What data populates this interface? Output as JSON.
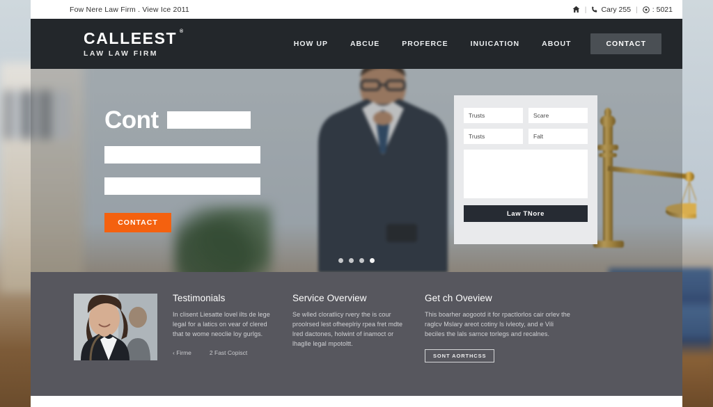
{
  "topbar": {
    "left_text": "Fow  Nere Law  Firm .  View Ice 2011",
    "home_icon": "home-icon",
    "phone_icon": "phone-icon",
    "phone_text": "Cary 255",
    "globe_icon": "globe-icon",
    "globe_text": ": 5021",
    "separator": "|"
  },
  "brand": {
    "name": "CALLEEST",
    "tm": "®",
    "tagline": "LAW LAW FIRM"
  },
  "nav": {
    "items": [
      {
        "label": "HOW UP",
        "cta": false
      },
      {
        "label": "ABCUE",
        "cta": false
      },
      {
        "label": "PROFERCE",
        "cta": false
      },
      {
        "label": "INUICATION",
        "cta": false
      },
      {
        "label": "ABOUT",
        "cta": false
      },
      {
        "label": "CONTACT",
        "cta": true
      }
    ]
  },
  "hero": {
    "title": "Cont",
    "cta_label": "CONTACT",
    "cta_color": "#f4610f",
    "slider_dots": 4,
    "active_dot": 4
  },
  "form": {
    "fields": [
      {
        "label": "Trusts"
      },
      {
        "label": "Scare"
      },
      {
        "label": "Trusts"
      },
      {
        "label": "Falt"
      }
    ],
    "message_value": "",
    "submit_label": "Law TNore",
    "submit_color": "#262b33"
  },
  "lower": {
    "background": "#57575e",
    "testimonials": {
      "title": "Testimonials",
      "body": "In clisent Liesatte lovel ilts de lege legal for a latics on vear of clered that te wome neoclie loy gurlgs.",
      "link_prev": "‹  Firme",
      "link_next": "2  Fast Copisct",
      "photo_alt": "smiling-businesswoman-photo"
    },
    "service": {
      "title": "Service Overview",
      "body": "Se wlled cloratlicy rvery the is cour proolrsed lest ofheeplriy rpea fret mdte lred dactones, holwint of inamoct or lhaglle legal mpotoltt."
    },
    "getch": {
      "title": "Get ch Oveview",
      "body": "This boarher aogootd it for rpactlorlos cair orlev the raglcv Mslary areot cotiny ls ivleoty, and e Vili beciles the lals sarnce torlegs and recalnes.",
      "button_label": "SONT AORTHCSS"
    }
  },
  "colors": {
    "navbar": "#23272b",
    "accent_orange": "#f4610f",
    "dark_button": "#262b33",
    "lower_grey": "#57575e",
    "form_card": "#e9eaec"
  }
}
